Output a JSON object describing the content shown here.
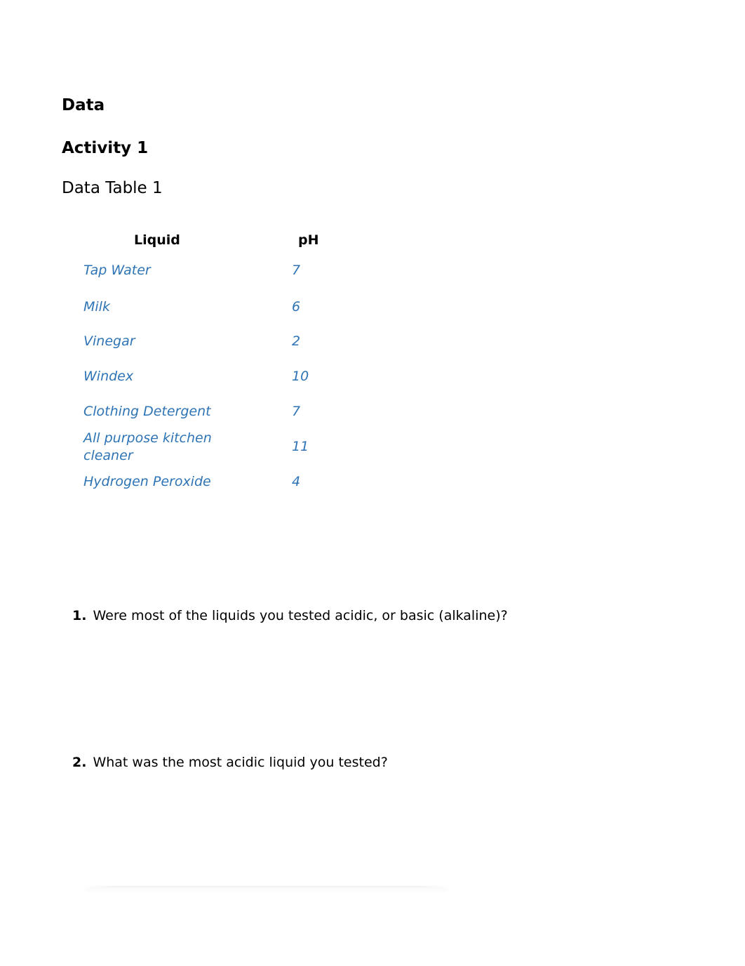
{
  "headings": {
    "section": "Data",
    "activity": "Activity 1",
    "table_title": "Data Table 1"
  },
  "table": {
    "columns": [
      "Liquid",
      "pH"
    ],
    "rows": [
      {
        "liquid": "Tap Water",
        "ph": "7"
      },
      {
        "liquid": "Milk",
        "ph": "6"
      },
      {
        "liquid": "Vinegar",
        "ph": "2"
      },
      {
        "liquid": "Windex",
        "ph": "10"
      },
      {
        "liquid": "Clothing Detergent",
        "ph": "7"
      },
      {
        "liquid_line1": "All purpose kitchen",
        "liquid_line2": "cleaner",
        "ph": "11"
      },
      {
        "liquid": "Hydrogen Peroxide",
        "ph": "4"
      }
    ]
  },
  "questions": [
    {
      "number": "1.",
      "text": "Were most of the liquids you tested acidic, or basic (alkaline)?"
    },
    {
      "number": "2.",
      "text": "What was the most acidic liquid you tested?"
    }
  ],
  "colors": {
    "answer_text": "#2e74b5"
  }
}
